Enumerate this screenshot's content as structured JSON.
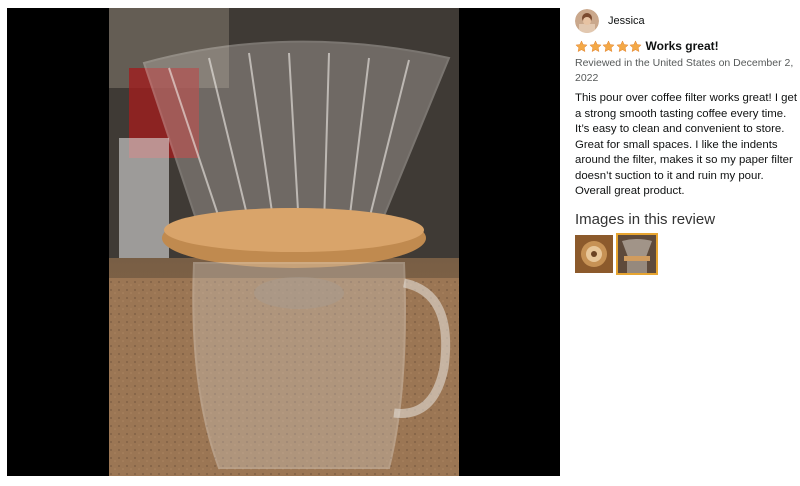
{
  "photo": {
    "icon": "product-photo"
  },
  "review": {
    "reviewer_name": "Jessica",
    "rating": 5,
    "rating_max": 5,
    "star_color": "#f3a847",
    "title": "Works great!",
    "date_line": "Reviewed in the United States on December 2, 2022",
    "body": "This pour over coffee filter works great! I get a strong smooth tasting coffee every time. It’s easy to clean and convenient to store. Great for small spaces. I like the indents around the filter, makes it so my paper filter doesn’t suction to it and ruin my pour. Overall great product.",
    "images_heading": "Images in this review",
    "thumbnails": [
      {
        "icon": "review-image-thumbnail",
        "selected": false
      },
      {
        "icon": "review-image-thumbnail",
        "selected": true
      }
    ],
    "selected_border_color": "#e7a531"
  }
}
